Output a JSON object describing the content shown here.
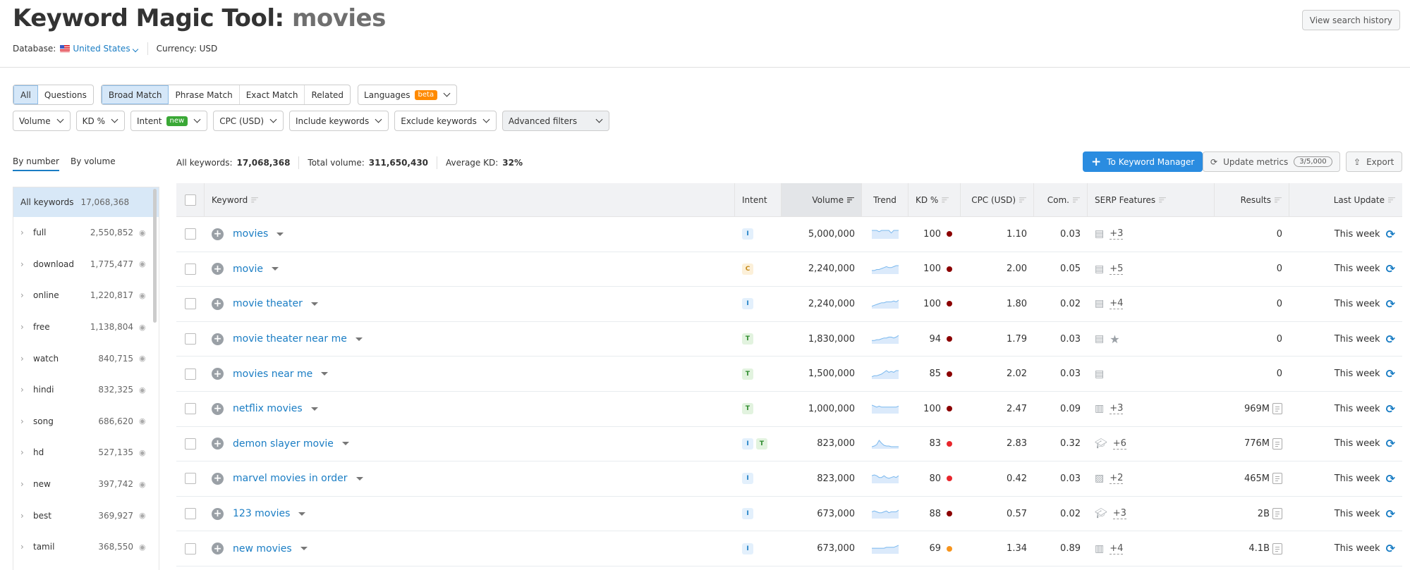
{
  "header": {
    "title": "Keyword Magic Tool:",
    "query": "movies",
    "database_label": "Database:",
    "database_value": "United States",
    "currency": "Currency: USD",
    "history_button": "View search history"
  },
  "filters": {
    "group1": [
      {
        "label": "All",
        "active": true
      },
      {
        "label": "Questions",
        "active": false
      }
    ],
    "group2": [
      {
        "label": "Broad Match",
        "active": true
      },
      {
        "label": "Phrase Match",
        "active": false
      },
      {
        "label": "Exact Match",
        "active": false
      },
      {
        "label": "Related",
        "active": false
      }
    ],
    "languages": {
      "label": "Languages",
      "badge": "beta",
      "badge_color": "#ff8a00"
    },
    "dropdowns": [
      {
        "label": "Volume"
      },
      {
        "label": "KD %"
      },
      {
        "label": "Intent",
        "badge": "new",
        "badge_color": "#3aa836"
      },
      {
        "label": "CPC (USD)"
      },
      {
        "label": "Include keywords"
      },
      {
        "label": "Exclude keywords"
      },
      {
        "label": "Advanced filters"
      }
    ]
  },
  "sidebar": {
    "tabs": [
      {
        "label": "By number",
        "active": true
      },
      {
        "label": "By volume",
        "active": false
      }
    ],
    "all": {
      "label": "All keywords",
      "count": "17,068,368"
    },
    "items": [
      {
        "label": "full",
        "count": "2,550,852"
      },
      {
        "label": "download",
        "count": "1,775,477"
      },
      {
        "label": "online",
        "count": "1,220,817"
      },
      {
        "label": "free",
        "count": "1,138,804"
      },
      {
        "label": "watch",
        "count": "840,715"
      },
      {
        "label": "hindi",
        "count": "832,325"
      },
      {
        "label": "song",
        "count": "686,620"
      },
      {
        "label": "hd",
        "count": "527,135"
      },
      {
        "label": "new",
        "count": "397,742"
      },
      {
        "label": "best",
        "count": "369,927"
      },
      {
        "label": "tamil",
        "count": "368,550"
      }
    ]
  },
  "summary": {
    "all_keywords_label": "All keywords:",
    "all_keywords": "17,068,368",
    "total_volume_label": "Total volume:",
    "total_volume": "311,650,430",
    "avg_kd_label": "Average KD:",
    "avg_kd": "32%"
  },
  "actions": {
    "to_manager": "To Keyword Manager",
    "update_metrics": "Update metrics",
    "update_quota": "3/5,000",
    "export": "Export"
  },
  "table": {
    "columns": [
      "Keyword",
      "Intent",
      "Volume",
      "Trend",
      "KD %",
      "CPC (USD)",
      "Com.",
      "SERP Features",
      "Results",
      "Last Update"
    ],
    "intent_colors": {
      "I": {
        "bg": "#e3f0fc",
        "fg": "#1a7dc4"
      },
      "C": {
        "bg": "#fcf0d9",
        "fg": "#c48a1a"
      },
      "T": {
        "bg": "#e2f3df",
        "fg": "#2e8b2e"
      }
    },
    "rows": [
      {
        "keyword": "movies",
        "intent": [
          "I"
        ],
        "volume": "5,000,000",
        "trend": [
          6,
          6,
          6,
          5,
          6,
          6,
          6,
          6,
          4,
          6,
          6,
          6
        ],
        "kd": "100",
        "kd_color": "#8b0000",
        "cpc": "1.10",
        "com": "0.03",
        "serp_icon": "featured-snippet",
        "serp_more": "+3",
        "results": "0",
        "results_icon": false,
        "updated": "This week"
      },
      {
        "keyword": "movie",
        "intent": [
          "C"
        ],
        "volume": "2,240,000",
        "trend": [
          3,
          3,
          4,
          4,
          5,
          6,
          7,
          6,
          6,
          7,
          8,
          8
        ],
        "kd": "100",
        "kd_color": "#8b0000",
        "cpc": "2.00",
        "com": "0.05",
        "serp_icon": "featured-snippet",
        "serp_more": "+5",
        "results": "0",
        "results_icon": false,
        "updated": "This week"
      },
      {
        "keyword": "movie theater",
        "intent": [
          "I"
        ],
        "volume": "2,240,000",
        "trend": [
          2,
          3,
          4,
          5,
          6,
          6,
          7,
          7,
          7,
          8,
          7,
          9
        ],
        "kd": "100",
        "kd_color": "#8b0000",
        "cpc": "1.80",
        "com": "0.02",
        "serp_icon": "featured-snippet",
        "serp_more": "+4",
        "results": "0",
        "results_icon": false,
        "updated": "This week"
      },
      {
        "keyword": "movie theater near me",
        "intent": [
          "T"
        ],
        "volume": "1,830,000",
        "trend": [
          3,
          3,
          4,
          4,
          5,
          6,
          6,
          7,
          7,
          6,
          7,
          9
        ],
        "kd": "94",
        "kd_color": "#8b0000",
        "cpc": "1.79",
        "com": "0.03",
        "serp_icon": "featured-snippet",
        "serp_more": "★",
        "results": "0",
        "results_icon": false,
        "updated": "This week"
      },
      {
        "keyword": "movies near me",
        "intent": [
          "T"
        ],
        "volume": "1,500,000",
        "trend": [
          2,
          3,
          3,
          4,
          5,
          7,
          9,
          7,
          8,
          7,
          9,
          9
        ],
        "kd": "85",
        "kd_color": "#8b0000",
        "cpc": "2.02",
        "com": "0.03",
        "serp_icon": "featured-snippet",
        "serp_more": "",
        "results": "0",
        "results_icon": false,
        "updated": "This week"
      },
      {
        "keyword": "netflix movies",
        "intent": [
          "T"
        ],
        "volume": "1,000,000",
        "trend": [
          8,
          7,
          6,
          7,
          6,
          6,
          6,
          6,
          6,
          6,
          6,
          7
        ],
        "kd": "100",
        "kd_color": "#8b0000",
        "cpc": "2.47",
        "com": "0.09",
        "serp_icon": "news",
        "serp_more": "+3",
        "results": "969M",
        "results_icon": true,
        "updated": "This week"
      },
      {
        "keyword": "demon slayer movie",
        "intent": [
          "I",
          "T"
        ],
        "volume": "823,000",
        "trend": [
          2,
          3,
          5,
          11,
          7,
          4,
          3,
          3,
          2,
          2,
          2,
          2
        ],
        "kd": "83",
        "kd_color": "#e8262c",
        "cpc": "2.83",
        "com": "0.32",
        "serp_icon": "knowledge-panel",
        "serp_more": "+6",
        "results": "776M",
        "results_icon": true,
        "updated": "This week"
      },
      {
        "keyword": "marvel movies in order",
        "intent": [
          "I"
        ],
        "volume": "823,000",
        "trend": [
          8,
          9,
          8,
          6,
          6,
          8,
          6,
          5,
          6,
          7,
          6,
          8
        ],
        "kd": "80",
        "kd_color": "#e8262c",
        "cpc": "0.42",
        "com": "0.03",
        "serp_icon": "image",
        "serp_more": "+2",
        "results": "465M",
        "results_icon": true,
        "updated": "This week"
      },
      {
        "keyword": "123 movies",
        "intent": [
          "I"
        ],
        "volume": "673,000",
        "trend": [
          7,
          8,
          7,
          6,
          6,
          7,
          8,
          6,
          7,
          7,
          7,
          9
        ],
        "kd": "88",
        "kd_color": "#8b0000",
        "cpc": "0.57",
        "com": "0.02",
        "serp_icon": "knowledge-panel",
        "serp_more": "+3",
        "results": "2B",
        "results_icon": true,
        "updated": "This week"
      },
      {
        "keyword": "new movies",
        "intent": [
          "I"
        ],
        "volume": "673,000",
        "trend": [
          5,
          5,
          5,
          5,
          5,
          5,
          6,
          6,
          6,
          6,
          7,
          8
        ],
        "kd": "69",
        "kd_color": "#f7941d",
        "cpc": "1.34",
        "com": "0.89",
        "serp_icon": "news",
        "serp_more": "+4",
        "results": "4.1B",
        "results_icon": true,
        "updated": "This week"
      }
    ]
  }
}
